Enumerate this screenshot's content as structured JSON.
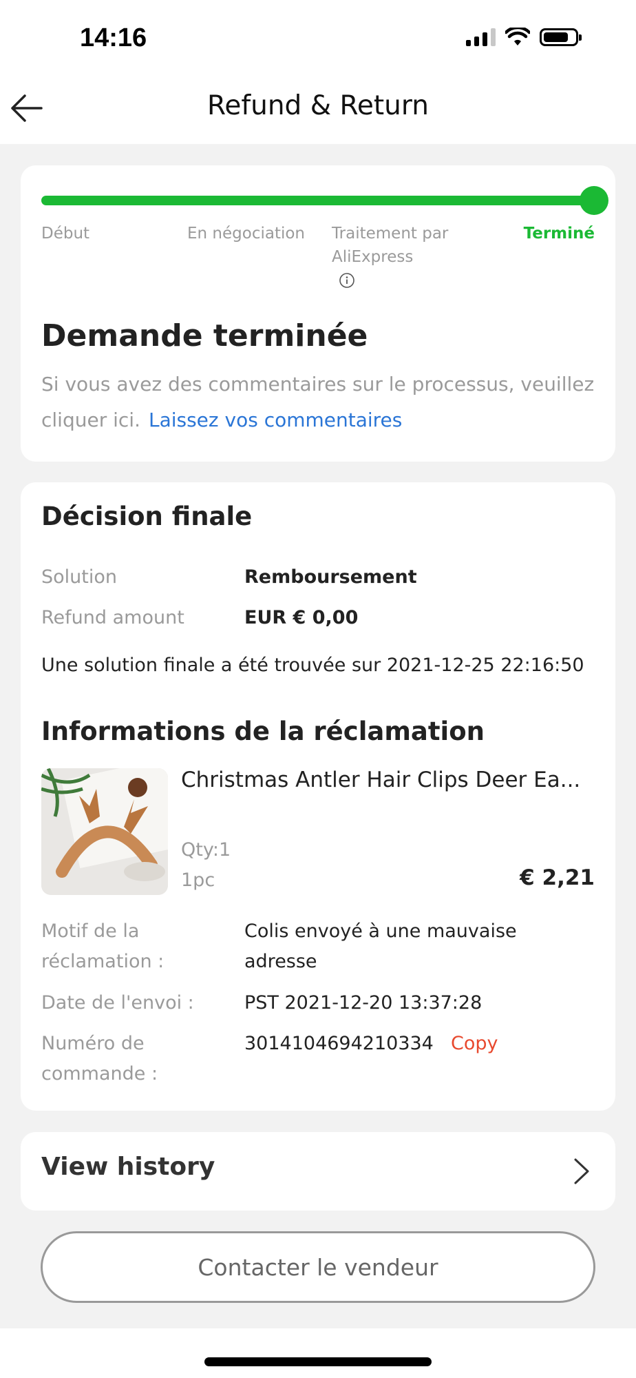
{
  "status_bar": {
    "time": "14:16"
  },
  "nav": {
    "title": "Refund & Return"
  },
  "progress": {
    "steps": [
      "Début",
      "En négociation",
      "Traitement par AliExpress",
      "Terminé"
    ],
    "current_step_index": 3,
    "completion": 1.0
  },
  "request": {
    "title": "Demande terminée",
    "feedback_text": "Si vous avez des commentaires sur le processus, veuillez cliquer ici.",
    "feedback_link": "Laissez vos commentaires"
  },
  "decision": {
    "title": "Décision finale",
    "solution_label": "Solution",
    "solution_value": "Remboursement",
    "refund_label": "Refund amount",
    "refund_value": "EUR € 0,00",
    "note": "Une solution finale a été trouvée sur 2021-12-25 22:16:50"
  },
  "claim": {
    "title": "Informations de la réclamation",
    "product_name": "Christmas Antler Hair Clips Deer Ea...",
    "qty": "Qty:1",
    "unit": "1pc",
    "price": "€ 2,21",
    "reason_label": "Motif de la réclamation :",
    "reason_value": "Colis envoyé à une mauvaise adresse",
    "ship_date_label": "Date de l'envoi :",
    "ship_date_value": "PST 2021-12-20 13:37:28",
    "order_label": "Numéro de commande :",
    "order_value": "3014104694210334",
    "copy_label": "Copy"
  },
  "history": {
    "label": "View history"
  },
  "contact": {
    "label": "Contacter le vendeur"
  },
  "colors": {
    "progress_green": "#1bb934",
    "link_blue": "#2a75d6",
    "copy_red": "#e8492e"
  }
}
